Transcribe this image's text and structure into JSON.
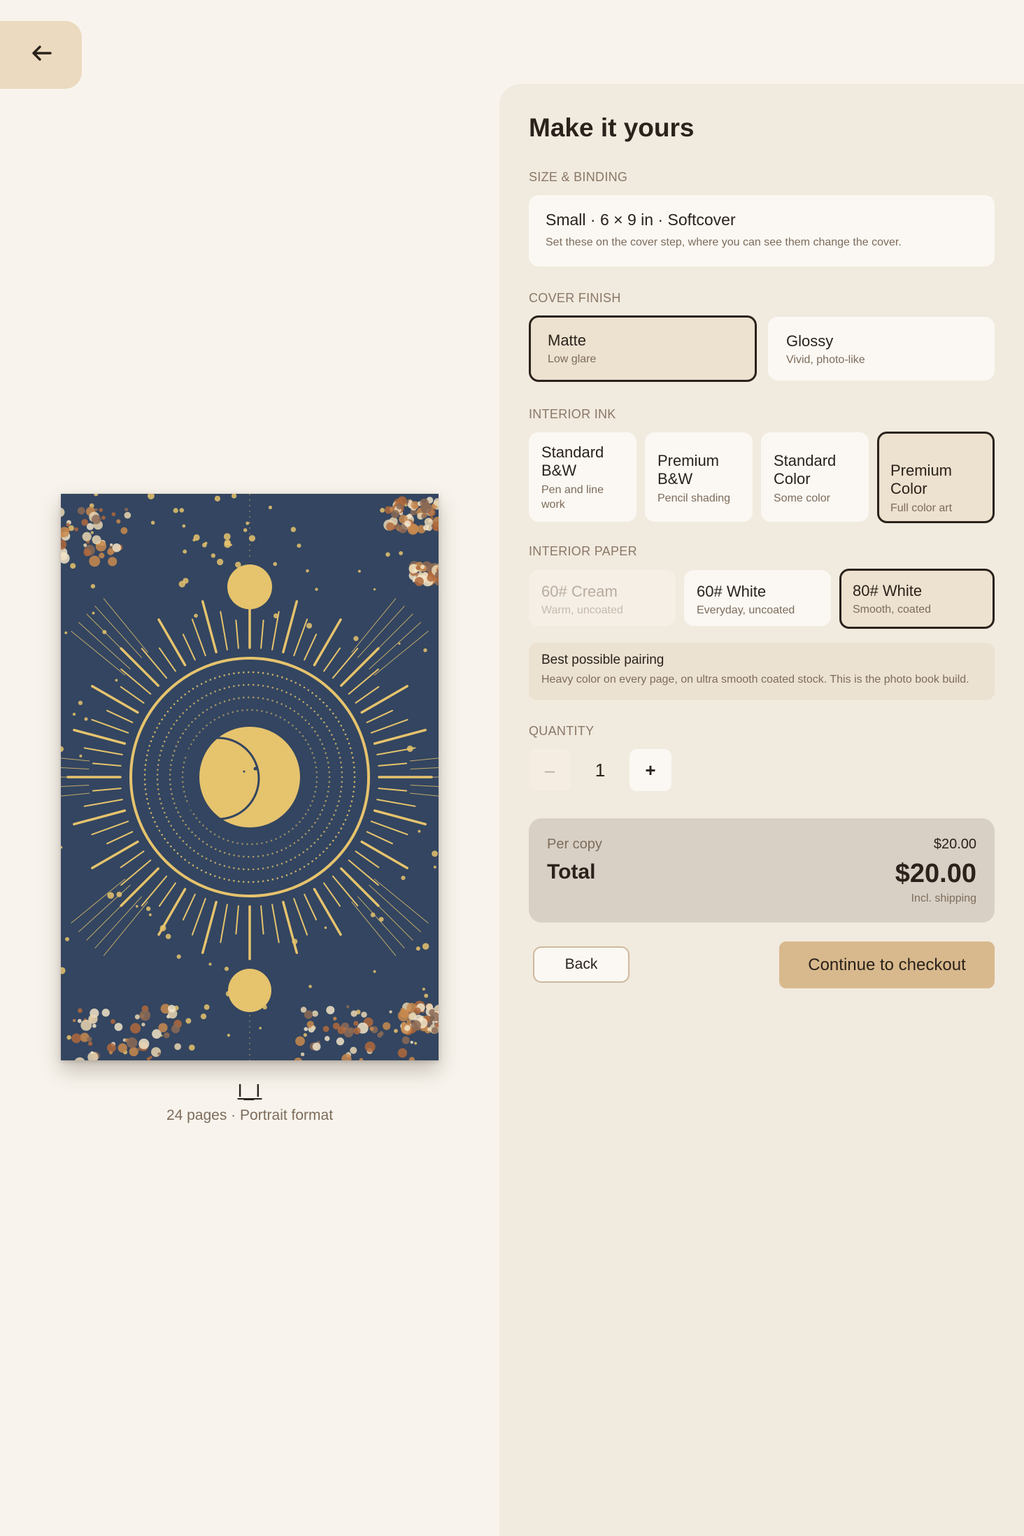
{
  "colors": {
    "page_bg": "#f8f4ed",
    "panel_bg": "#f1eadf",
    "accent": "#d8b98d",
    "cover_navy": "#334560",
    "cover_gold": "#e6c36d",
    "text": "#2a221b"
  },
  "nav": {
    "back_icon": "arrow-left-icon"
  },
  "preview": {
    "title": "I_I",
    "meta": "24 pages · Portrait format"
  },
  "panel": {
    "heading": "Make it yours",
    "size_binding": {
      "label": "SIZE & BINDING",
      "value": "Small · 6 × 9 in  ·  Softcover",
      "hint": "Set these on the cover step, where you can see them change the cover."
    },
    "cover_finish": {
      "label": "COVER FINISH",
      "selected": "Matte",
      "options": [
        {
          "title": "Matte",
          "subtitle": "Low glare"
        },
        {
          "title": "Glossy",
          "subtitle": "Vivid, photo-like"
        }
      ]
    },
    "interior_ink": {
      "label": "INTERIOR INK",
      "selected": "Premium Color",
      "options": [
        {
          "title": "Standard B&W",
          "subtitle": "Pen and line work"
        },
        {
          "title": "Premium B&W",
          "subtitle": "Pencil shading"
        },
        {
          "title": "Standard Color",
          "subtitle": "Some color"
        },
        {
          "title": "Premium Color",
          "subtitle": "Full color art"
        }
      ]
    },
    "interior_paper": {
      "label": "INTERIOR PAPER",
      "selected": "80# White",
      "options": [
        {
          "title": "60# Cream",
          "subtitle": "Warm, uncoated",
          "disabled": true
        },
        {
          "title": "60# White",
          "subtitle": "Everyday, uncoated"
        },
        {
          "title": "80# White",
          "subtitle": "Smooth, coated"
        }
      ]
    },
    "pairing": {
      "title": "Best possible pairing",
      "text": "Heavy color on every page, on ultra smooth coated stock. This is the photo book build."
    },
    "quantity": {
      "label": "QUANTITY",
      "minus": "–",
      "value": "1",
      "plus": "+"
    },
    "summary": {
      "per_copy_label": "Per copy",
      "per_copy_value": "$20.00",
      "total_label": "Total",
      "total_value": "$20.00",
      "shipping_note": "Incl. shipping"
    },
    "actions": {
      "back": "Back",
      "checkout": "Continue to checkout"
    }
  }
}
